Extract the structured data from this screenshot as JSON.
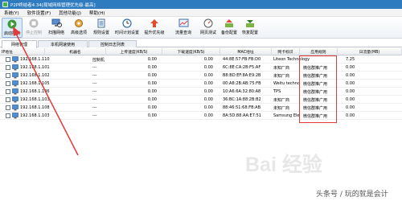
{
  "window": {
    "title": "P2P终结者4.34[局域网络管理优先级-最高]"
  },
  "menu": [
    "系统(Y)",
    "软件设置(F)",
    "其他功能(J)",
    "帮助(H)"
  ],
  "toolbar": [
    {
      "label": "启动控制",
      "icon": "play-icon"
    },
    {
      "label": "停止控制",
      "icon": "stop-icon"
    },
    {
      "label": "扫描网络",
      "icon": "scan-icon"
    },
    {
      "label": "高级选项",
      "icon": "settings-icon"
    },
    {
      "label": "规则设置",
      "icon": "rules-icon"
    },
    {
      "label": "时间计划设置",
      "icon": "clock-icon"
    },
    {
      "label": "提升优先级",
      "icon": "priority-icon"
    },
    {
      "label": "流量查询",
      "icon": "chart-icon"
    },
    {
      "label": "网页测试",
      "icon": "gauge-icon"
    },
    {
      "label": "备份配置",
      "icon": "backup-icon"
    },
    {
      "label": "恢复配置",
      "icon": "restore-icon"
    }
  ],
  "tabs": [
    "网络管理",
    "本机网速使用",
    "控制日志列表"
  ],
  "columns": [
    "IP地址",
    "机器名",
    "上传速度(KB/S)",
    "下载速度(KB/S)",
    "MAC地址",
    "网卡标识",
    "应用规则",
    "日流量(MB)"
  ],
  "rows": [
    {
      "ip": "192.168.1.110",
      "name": "控制机",
      "up": "0.00",
      "down": "0.00",
      "mac": "44:8E:57:FB:FB:D0",
      "nic": "Liteon Technology",
      "rule": "",
      "flow": "7.25"
    },
    {
      "ip": "192.168.1.101",
      "name": "---",
      "up": "0.00",
      "down": "0.00",
      "mac": "6C:8E:CA:2B:F5:AF",
      "nic": "未知厂商",
      "rule": "微信群推广用",
      "flow": "0.00"
    },
    {
      "ip": "192.168.1.102",
      "name": "---",
      "up": "0.00",
      "down": "0.00",
      "mac": "B8:BD:EF:8A:E9:2B",
      "nic": "未知厂商",
      "rule": "微信群推广用",
      "flow": "0.00"
    },
    {
      "ip": "192.168.1.105",
      "name": "---",
      "up": "0.00",
      "down": "0.00",
      "mac": "00:A8:2B:AB:75:FB",
      "nic": "Weitu technology co",
      "rule": "微信群推广用",
      "flow": "0.00"
    },
    {
      "ip": "192.168.1.106",
      "name": "---",
      "up": "0.00",
      "down": "0.00",
      "mac": "10:A6:6A:32:80:A8",
      "nic": "TPS",
      "rule": "微信群推广用",
      "flow": "0.00"
    },
    {
      "ip": "192.168.1.103",
      "name": "---",
      "up": "0.00",
      "down": "0.00",
      "mac": "36:BC:1A:88:2B:B2",
      "nic": "未知厂商",
      "rule": "微信群推广用",
      "flow": "0.00"
    },
    {
      "ip": "192.168.1.108",
      "name": "---",
      "up": "0.00",
      "down": "0.00",
      "mac": "88:46:51:68:FB:AB",
      "nic": "未知厂商",
      "rule": "微信群推广用",
      "flow": "0.00"
    },
    {
      "ip": "192.168.1.103",
      "name": "---",
      "up": "0.00",
      "down": "0.00",
      "mac": "8A:5D:88:AA:E7:51",
      "nic": "Samsung Electronic...",
      "rule": "微信群推广用",
      "flow": "0.00"
    }
  ],
  "watermark": "Bai 经验",
  "footer": "头条号 / 玩的就是会计",
  "colors": {
    "titlebar": "#2f7bbf",
    "highlight": "#e53935",
    "accent_rule": "#000000"
  }
}
